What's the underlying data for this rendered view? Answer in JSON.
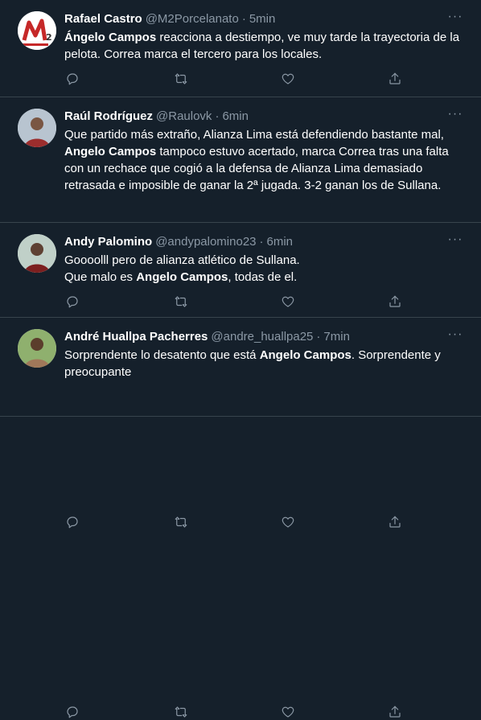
{
  "tweets": [
    {
      "name": "Rafael Castro",
      "handle": "@M2Porcelanato",
      "separator": "·",
      "time": "5min",
      "text_segments": [
        {
          "text": "Ángelo Campos",
          "bold": true
        },
        {
          "text": " reacciona a destiempo, ve muy tarde la trayectoria de la pelota. Correa marca el tercero para los locales.",
          "bold": false
        }
      ],
      "avatar": "m2-logo-avatar"
    },
    {
      "name": "Raúl Rodríguez",
      "handle": "@Raulovk",
      "separator": "·",
      "time": "6min",
      "text_segments": [
        {
          "text": "Que partido más extraño, Alianza Lima está defendiendo bastante mal, ",
          "bold": false
        },
        {
          "text": "Angelo Campos",
          "bold": true
        },
        {
          "text": " tampoco estuvo acertado, marca Correa tras una falta con un rechace que cogió a la defensa de Alianza Lima demasiado retrasada e imposible de ganar la 2ª jugada. 3-2 ganan los de Sullana.",
          "bold": false
        }
      ],
      "avatar": "photo-avatar"
    },
    {
      "name": "Andy Palomino",
      "handle": "@andypalomino23",
      "separator": "·",
      "time": "6min",
      "text_segments": [
        {
          "text": "Goooolll pero de alianza atlético de Sullana.",
          "bold": false
        },
        {
          "text": "\n",
          "bold": false
        },
        {
          "text": "Que malo es ",
          "bold": false
        },
        {
          "text": "Angelo Campos",
          "bold": true
        },
        {
          "text": ", todas de el.",
          "bold": false
        }
      ],
      "avatar": "photo-avatar"
    },
    {
      "name": "André Huallpa Pacherres",
      "handle": "@andre_huallpa25",
      "separator": "·",
      "time": "7min",
      "text_segments": [
        {
          "text": "Sorprendente lo desatento que está ",
          "bold": false
        },
        {
          "text": "Angelo Campos",
          "bold": true
        },
        {
          "text": ". Sorprendente y preocupante",
          "bold": false
        }
      ],
      "avatar": "photo-avatar"
    }
  ],
  "actions": [
    "reply-icon",
    "retweet-icon",
    "like-icon",
    "share-icon"
  ],
  "more_label": "···",
  "colors": {
    "background": "#15202b",
    "border": "#38444d",
    "muted": "#8b98a5",
    "text": "#ffffff"
  }
}
